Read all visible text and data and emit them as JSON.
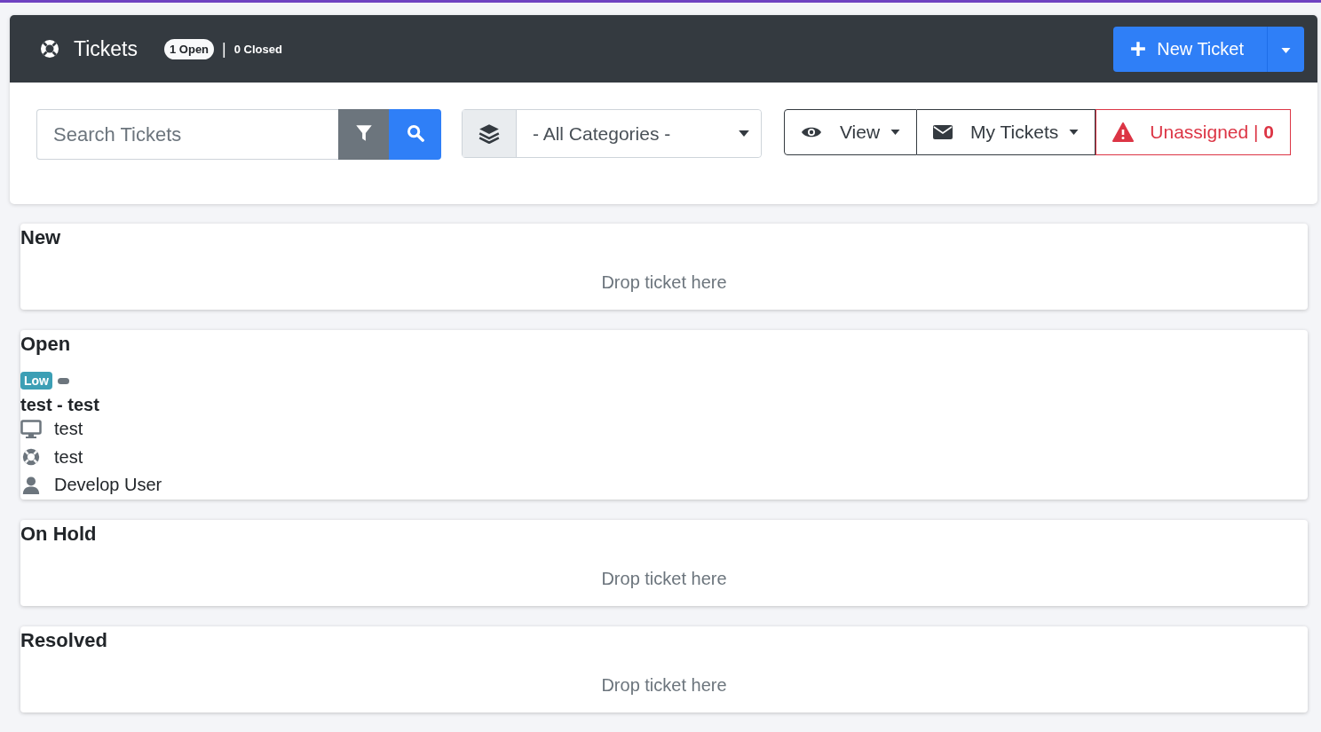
{
  "header": {
    "title": "Tickets",
    "open_count": "1 Open",
    "separator": "|",
    "closed_count": "0 Closed",
    "new_button": "New Ticket"
  },
  "filters": {
    "search": {
      "placeholder": "Search Tickets"
    },
    "category": "- All Categories -",
    "view": "View",
    "my_tickets": "My Tickets",
    "unassigned": "Unassigned | **0**"
  },
  "lanes": [
    {
      "title": "New",
      "placeholder": "Drop ticket here"
    },
    {
      "title": "Open",
      "tickets": [
        {
          "priority": "Low",
          "color": "#3c9fb5",
          "title": "test - test",
          "fields": [
            {
              "kind": "device",
              "text": "test"
            },
            {
              "kind": "category",
              "text": "test"
            },
            {
              "kind": "user",
              "text": "Develop User"
            }
          ]
        }
      ]
    },
    {
      "title": "On Hold",
      "placeholder": "Drop ticket here"
    },
    {
      "title": "Resolved",
      "placeholder": "Drop ticket here"
    }
  ]
}
